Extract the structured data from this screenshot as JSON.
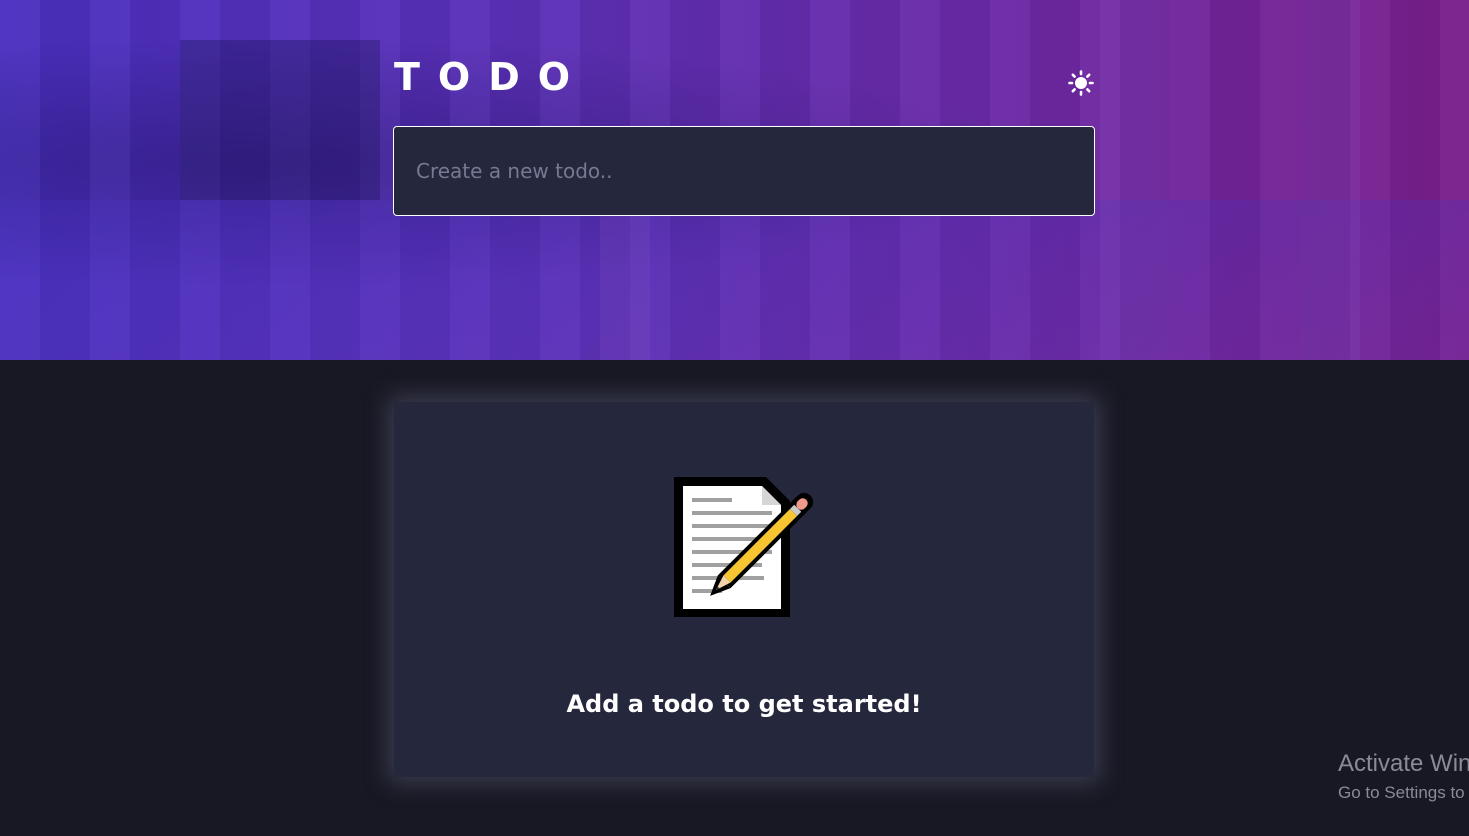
{
  "header": {
    "title": "TODO",
    "theme_toggle_icon": "sun-icon"
  },
  "new_todo": {
    "placeholder": "Create a new todo.."
  },
  "empty_state": {
    "icon": "memo-icon",
    "message": "Add a todo to get started!"
  },
  "watermark": {
    "line1": "Activate Win",
    "line2": "Go to Settings to"
  },
  "colors": {
    "background": "#171823",
    "card": "#25273d",
    "gradient_start": "#4a2fc0",
    "gradient_end": "#7a1f8c",
    "text_primary": "#ffffff",
    "placeholder": "#767992"
  }
}
